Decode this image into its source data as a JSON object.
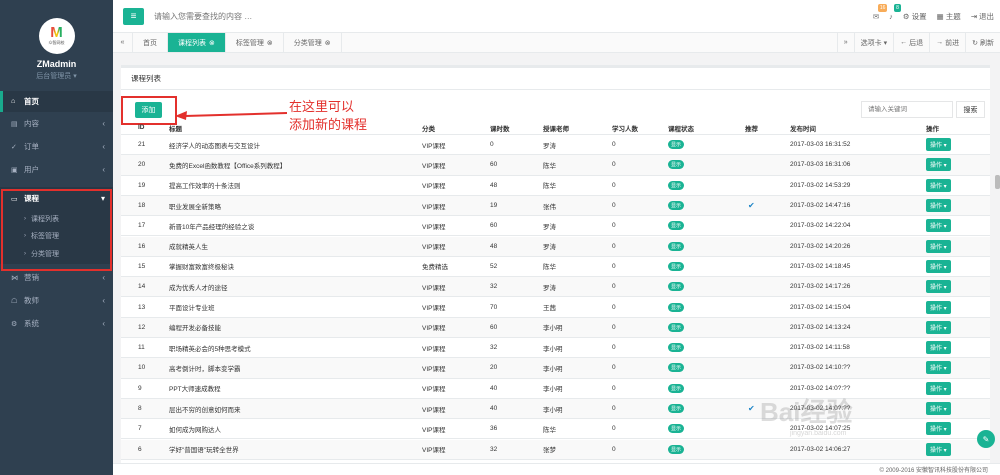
{
  "app": {
    "user_name": "ZMadmin",
    "user_role": "后台管理员 ▾",
    "logo_letter": "M",
    "logo_sub": "众智网校"
  },
  "sidebar": {
    "items": [
      {
        "label": "首页",
        "icon": "home-icon"
      },
      {
        "label": "内容",
        "icon": "content-icon"
      },
      {
        "label": "订单",
        "icon": "cart-icon"
      },
      {
        "label": "用户",
        "icon": "user-icon"
      },
      {
        "label": "课程",
        "icon": "book-icon"
      },
      {
        "label": "营销",
        "icon": "share-icon"
      },
      {
        "label": "教师",
        "icon": "teacher-icon"
      },
      {
        "label": "系统",
        "icon": "gear-icon"
      }
    ],
    "sub_items": [
      "课程列表",
      "标签管理",
      "分类管理"
    ]
  },
  "topbar": {
    "search_placeholder": "请输入您需要查找的内容 …",
    "mail_badge": "16",
    "bell_badge": "8",
    "settings_label": "设置",
    "theme_label": "主题",
    "logout_label": "退出"
  },
  "tabs": {
    "items": [
      "首页",
      "课程列表",
      "标签管理",
      "分类管理"
    ],
    "tab_options": "选项卡 ▾",
    "back": "后退",
    "forward": "前进",
    "refresh": "刷新"
  },
  "panel": {
    "title": "课程列表",
    "add_label": "添加",
    "keyword_placeholder": "请输入关键词",
    "search_label": "搜索"
  },
  "annotation": {
    "line1": "在这里可以",
    "line2": "添加新的课程"
  },
  "table": {
    "headers": [
      "ID",
      "标题",
      "分类",
      "课时数",
      "授课老师",
      "学习人数",
      "课程状态",
      "推荐",
      "发布时间",
      "操作"
    ],
    "status_label": "显示",
    "op_label": "操作 ▾",
    "rows": [
      {
        "id": "21",
        "title": "经济学人的动态图表与交互设计",
        "cat": "VIP课程",
        "hrs": "0",
        "teacher": "罗涛",
        "students": "0",
        "rec": false,
        "time": "2017-03-03 16:31:52"
      },
      {
        "id": "20",
        "title": "免费的Excel函数教程【Office系列教程】",
        "cat": "VIP课程",
        "hrs": "60",
        "teacher": "陈华",
        "students": "0",
        "rec": false,
        "time": "2017-03-03 16:31:06"
      },
      {
        "id": "19",
        "title": "提高工作效率的十条法则",
        "cat": "VIP课程",
        "hrs": "48",
        "teacher": "陈华",
        "students": "0",
        "rec": false,
        "time": "2017-03-02 14:53:29"
      },
      {
        "id": "18",
        "title": "职业发展全新策略",
        "cat": "VIP课程",
        "hrs": "19",
        "teacher": "张伟",
        "students": "0",
        "rec": true,
        "time": "2017-03-02 14:47:16"
      },
      {
        "id": "17",
        "title": "新晋10年产品经理的经验之谈",
        "cat": "VIP课程",
        "hrs": "60",
        "teacher": "罗涛",
        "students": "0",
        "rec": false,
        "time": "2017-03-02 14:22:04"
      },
      {
        "id": "16",
        "title": "成就精英人生",
        "cat": "VIP课程",
        "hrs": "48",
        "teacher": "罗涛",
        "students": "0",
        "rec": false,
        "time": "2017-03-02 14:20:26"
      },
      {
        "id": "15",
        "title": "掌握财富致富终极秘诀",
        "cat": "免费精选",
        "hrs": "52",
        "teacher": "陈华",
        "students": "0",
        "rec": false,
        "time": "2017-03-02 14:18:45"
      },
      {
        "id": "14",
        "title": "成为优秀人才的途径",
        "cat": "VIP课程",
        "hrs": "32",
        "teacher": "罗涛",
        "students": "0",
        "rec": false,
        "time": "2017-03-02 14:17:26"
      },
      {
        "id": "13",
        "title": "平面设计专业班",
        "cat": "VIP课程",
        "hrs": "70",
        "teacher": "王茜",
        "students": "0",
        "rec": false,
        "time": "2017-03-02 14:15:04"
      },
      {
        "id": "12",
        "title": "编程开发必备技能",
        "cat": "VIP课程",
        "hrs": "60",
        "teacher": "李小明",
        "students": "0",
        "rec": false,
        "time": "2017-03-02 14:13:24"
      },
      {
        "id": "11",
        "title": "职场精英必会的5种思考模式",
        "cat": "VIP课程",
        "hrs": "32",
        "teacher": "李小明",
        "students": "0",
        "rec": false,
        "time": "2017-03-02 14:11:58"
      },
      {
        "id": "10",
        "title": "高考倒计时，脚本变学霸",
        "cat": "VIP课程",
        "hrs": "20",
        "teacher": "李小明",
        "students": "0",
        "rec": false,
        "time": "2017-03-02 14:10:??"
      },
      {
        "id": "9",
        "title": "PPT大师速成教程",
        "cat": "VIP课程",
        "hrs": "40",
        "teacher": "李小明",
        "students": "0",
        "rec": false,
        "time": "2017-03-02 14:0?:??"
      },
      {
        "id": "8",
        "title": "层出不穷的创意如何而来",
        "cat": "VIP课程",
        "hrs": "40",
        "teacher": "李小明",
        "students": "0",
        "rec": true,
        "time": "2017-03-02 14:0?:??"
      },
      {
        "id": "7",
        "title": "如何成为网购达人",
        "cat": "VIP课程",
        "hrs": "36",
        "teacher": "陈华",
        "students": "0",
        "rec": false,
        "time": "2017-03-02 14:07:25"
      },
      {
        "id": "6",
        "title": "学好\"普国语\"玩转全世界",
        "cat": "VIP课程",
        "hrs": "32",
        "teacher": "张梦",
        "students": "0",
        "rec": false,
        "time": "2017-03-02 14:06:27"
      }
    ]
  },
  "footer": {
    "text": "© 2009-2016 安徽智讯科技股份有限公司"
  },
  "watermark": {
    "main": "Bai经验",
    "sub": "jingyan.baidu.com"
  },
  "colors": {
    "sidebar": "#2f4050",
    "accent": "#1ab394",
    "annotation": "#e3302c",
    "check": "#1c84c6"
  }
}
